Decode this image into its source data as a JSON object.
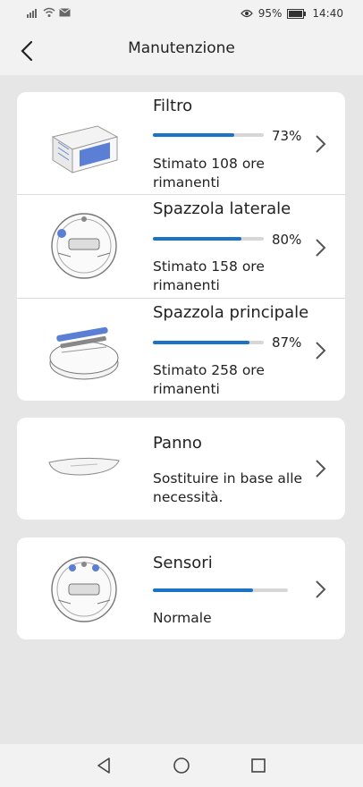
{
  "status_bar": {
    "battery": "95%",
    "time": "14:40",
    "icons": [
      "signal-icon",
      "wifi-icon",
      "mail-icon",
      "eye-icon",
      "battery-icon"
    ]
  },
  "header": {
    "title": "Manutenzione",
    "back_icon": "chevron-left-icon"
  },
  "items": [
    {
      "title": "Filtro",
      "percent": "73%",
      "progress": 0.73,
      "desc": "Stimato 108 ore rimanenti"
    },
    {
      "title": "Spazzola laterale",
      "percent": "80%",
      "progress": 0.8,
      "desc": "Stimato 158 ore rimanenti"
    },
    {
      "title": "Spazzola principale",
      "percent": "87%",
      "progress": 0.87,
      "desc": "Stimato 258 ore rimanenti"
    },
    {
      "title": "Panno",
      "desc": "Sostituire in base alle necessità."
    },
    {
      "title": "Sensori",
      "progress": 0.74,
      "desc": "Normale"
    }
  ],
  "nav": {
    "icons": [
      "back-triangle-icon",
      "home-circle-icon",
      "recents-square-icon"
    ]
  },
  "colors": {
    "accent": "#1b73c5",
    "track": "#d7d7d7",
    "background": "#e6e6e6"
  }
}
